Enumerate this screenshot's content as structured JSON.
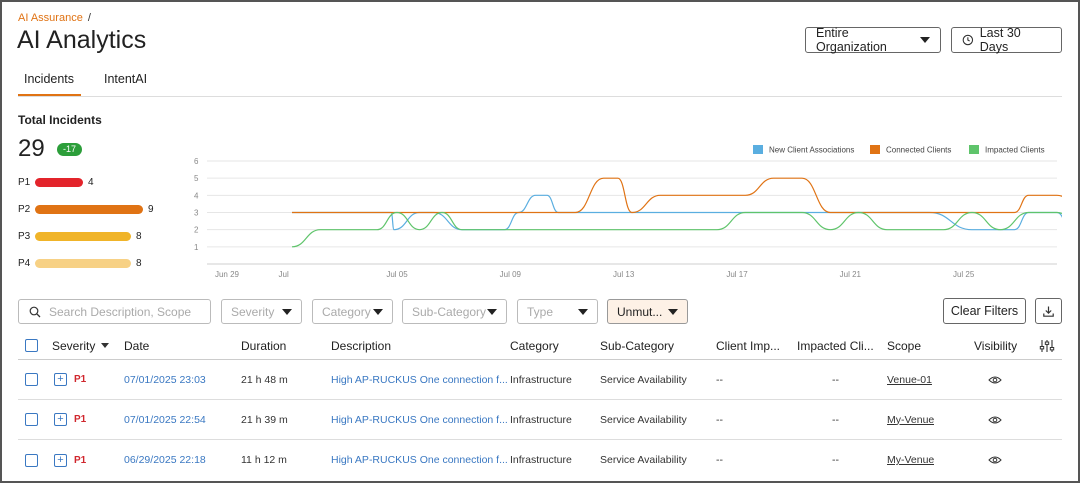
{
  "breadcrumb": {
    "root": "AI Assurance",
    "separator": "/"
  },
  "page_title": "AI Analytics",
  "header": {
    "org_select": "Entire Organization",
    "date_range": "Last 30 Days"
  },
  "tabs": [
    {
      "label": "Incidents",
      "active": true
    },
    {
      "label": "IntentAI",
      "active": false
    }
  ],
  "summary": {
    "label": "Total Incidents",
    "total": "29",
    "delta": "-17",
    "priorities": [
      {
        "label": "P1",
        "count": 4,
        "color": "#e3242b"
      },
      {
        "label": "P2",
        "count": 9,
        "color": "#e07314"
      },
      {
        "label": "P3",
        "count": 8,
        "color": "#f0b429"
      },
      {
        "label": "P4",
        "count": 8,
        "color": "#f7d185"
      }
    ]
  },
  "chart_data": {
    "type": "line",
    "x_ticks": [
      "Jun 29",
      "Jul",
      "Jul 05",
      "Jul 09",
      "Jul 13",
      "Jul 17",
      "Jul 21",
      "Jul 25"
    ],
    "y_ticks": [
      "6",
      "5",
      "4",
      "3",
      "2",
      "1"
    ],
    "ylim": [
      0,
      6
    ],
    "grid": true,
    "legend_position": "top-right",
    "series": [
      {
        "name": "New Client Associations",
        "color": "#5aaee0",
        "x": [
          0,
          1.2,
          3.5,
          3.6,
          4.5,
          5,
          6,
          6.8,
          7.5,
          8,
          8.6,
          9,
          9.4,
          10,
          10.6,
          11.4,
          12,
          13,
          18,
          21,
          22.5,
          24,
          25.5,
          26,
          27,
          27.5,
          28,
          29,
          29.8
        ],
        "y": [
          3,
          3,
          3,
          2,
          3,
          3,
          2,
          2,
          2,
          3,
          4,
          4,
          3,
          3,
          3,
          3,
          3,
          3,
          3,
          3,
          3,
          2,
          2,
          3,
          3,
          2,
          2,
          2,
          3
        ]
      },
      {
        "name": "Connected Clients",
        "color": "#e07314",
        "x": [
          0,
          1,
          8,
          9,
          10,
          11,
          11.5,
          12,
          13,
          14,
          15,
          16,
          17,
          18,
          19,
          20,
          21,
          22,
          23,
          24,
          25,
          25.5,
          26,
          27,
          28,
          29,
          29.8
        ],
        "y": [
          3,
          3,
          3,
          3,
          3,
          5,
          5,
          3,
          4,
          4,
          4,
          4,
          5,
          5,
          3,
          3,
          3,
          3,
          3,
          3,
          3,
          3,
          4,
          4,
          3,
          3,
          3
        ]
      },
      {
        "name": "Impacted Clients",
        "color": "#5fc46b",
        "x": [
          0,
          1,
          2,
          3,
          3.7,
          4.5,
          5.3,
          6,
          6.8,
          7.5,
          8.3,
          9,
          15,
          16,
          17,
          18,
          19,
          20,
          21,
          22,
          23,
          24,
          25,
          26,
          27,
          28,
          29
        ],
        "y": [
          1,
          2,
          2,
          2,
          3,
          2,
          3,
          2,
          2,
          2,
          2,
          2,
          2,
          3,
          3,
          3,
          2,
          3,
          2,
          2,
          2,
          3,
          2,
          3,
          3,
          2,
          3
        ]
      }
    ]
  },
  "filters": {
    "search_placeholder": "Search Description, Scope",
    "severity": "Severity",
    "category": "Category",
    "sub_category": "Sub-Category",
    "type": "Type",
    "mute": "Unmut...",
    "clear_label": "Clear Filters"
  },
  "table": {
    "columns": [
      "Severity",
      "Date",
      "Duration",
      "Description",
      "Category",
      "Sub-Category",
      "Client Imp...",
      "Impacted Cli...",
      "Scope",
      "Visibility"
    ],
    "rows": [
      {
        "severity": "P1",
        "date": "07/01/2025 23:03",
        "duration": "21 h 48 m",
        "description": "High AP-RUCKUS One connection f...",
        "category": "Infrastructure",
        "sub_category": "Service Availability",
        "client_impact": "--",
        "impacted_clients": "--",
        "scope": "Venue-01"
      },
      {
        "severity": "P1",
        "date": "07/01/2025 22:54",
        "duration": "21 h 39 m",
        "description": "High AP-RUCKUS One connection f...",
        "category": "Infrastructure",
        "sub_category": "Service Availability",
        "client_impact": "--",
        "impacted_clients": "--",
        "scope": "My-Venue"
      },
      {
        "severity": "P1",
        "date": "06/29/2025 22:18",
        "duration": "11 h 12 m",
        "description": "High AP-RUCKUS One connection f...",
        "category": "Infrastructure",
        "sub_category": "Service Availability",
        "client_impact": "--",
        "impacted_clients": "--",
        "scope": "My-Venue"
      }
    ]
  }
}
